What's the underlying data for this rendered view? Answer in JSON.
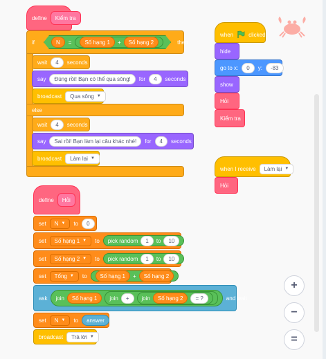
{
  "script1": {
    "define_label": "define",
    "define_name": "Kiểm tra",
    "if_label": "if",
    "then_label": "then",
    "var_n": "N",
    "eq": "=",
    "term1": "Số hạng 1",
    "plus": "+",
    "term2": "Số hạng 2",
    "wait_label": "wait",
    "wait_value": "4",
    "seconds_label": "seconds",
    "say_label": "say",
    "say_correct": "Đúng rồi! Bạn có thể qua sông!",
    "for_label": "for",
    "say_value": "4",
    "broadcast_label": "broadcast",
    "broadcast_cross": "Qua sông",
    "else_label": "else",
    "wait_value2": "4",
    "say_wrong": "Sai rồi! Bạn làm lại câu khác nhé!",
    "say_value2": "4",
    "broadcast_redo": "Làm lại"
  },
  "script2": {
    "define_label": "define",
    "define_name": "Hỏi",
    "set_label": "set",
    "to_label": "to",
    "var_n": "N",
    "n_value": "0",
    "var_t1": "Số hạng 1",
    "var_t2": "Số hạng 2",
    "var_sum": "Tổng",
    "pick_random": "pick random",
    "rand_from": "1",
    "rand_to_label": "to",
    "rand_to": "10",
    "plus": "+",
    "ask_label": "ask",
    "join_label": "join",
    "join_plus": "+",
    "join_question": "= ?",
    "and_wait": "and wait",
    "answer": "answer",
    "broadcast_label": "broadcast",
    "broadcast_answer": "Trả lời"
  },
  "script3": {
    "when_label": "when",
    "clicked_label": "clicked",
    "hide": "hide",
    "goto_label": "go to x:",
    "x_value": "0",
    "y_label": "y:",
    "y_value": "-83",
    "show": "show",
    "hoi": "Hỏi",
    "kiem_tra": "Kiểm tra"
  },
  "script4": {
    "when_receive": "when I receive",
    "message": "Làm lại",
    "hoi": "Hỏi"
  },
  "zoom": {
    "zoom_in": "+",
    "zoom_out": "−",
    "reset": "="
  },
  "colors": {
    "control": "#ffab19",
    "operators": "#59c059",
    "looks": "#9966ff",
    "motion": "#4c97ff",
    "events": "#ffbf00",
    "variables": "#ff8c1a",
    "sensing": "#5cb1d6",
    "my_blocks": "#ff6680"
  }
}
